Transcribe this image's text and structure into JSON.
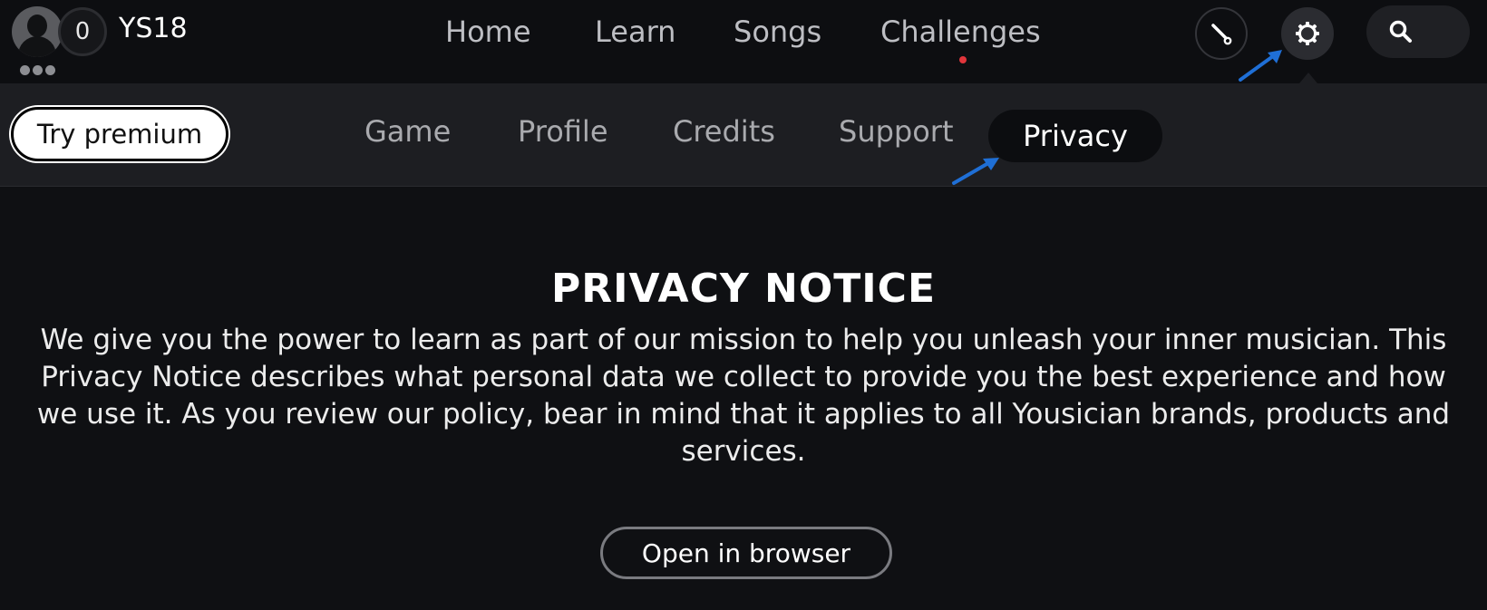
{
  "user": {
    "level": "0",
    "name": "YS18",
    "avatar_icon": "user-silhouette-icon",
    "more_icon": "more-dots-icon"
  },
  "main_nav": {
    "items": [
      "Home",
      "Learn",
      "Songs",
      "Challenges"
    ],
    "challenges_notification": true,
    "notification_color": "#e0353b"
  },
  "toolbar_icons": {
    "tuner": "tuner-icon",
    "settings": "gear-icon",
    "search": "search-icon"
  },
  "sub_nav": {
    "premium_label": "Try premium",
    "items": [
      "Game",
      "Profile",
      "Credits",
      "Support",
      "Privacy"
    ],
    "active": "Privacy"
  },
  "notice": {
    "title": "PRIVACY NOTICE",
    "body": "We give you the power to learn as part of our mission to help you unleash your inner musician. This Privacy Notice describes what personal data we collect to provide you the best experience and how we use it. As you review our policy, bear in mind that it applies to all Yousician brands, products and services.",
    "button_label": "Open in browser"
  },
  "colors": {
    "background": "#0f1013",
    "subbar": "#1d1e22",
    "annotation_arrow": "#1f6fd6"
  }
}
